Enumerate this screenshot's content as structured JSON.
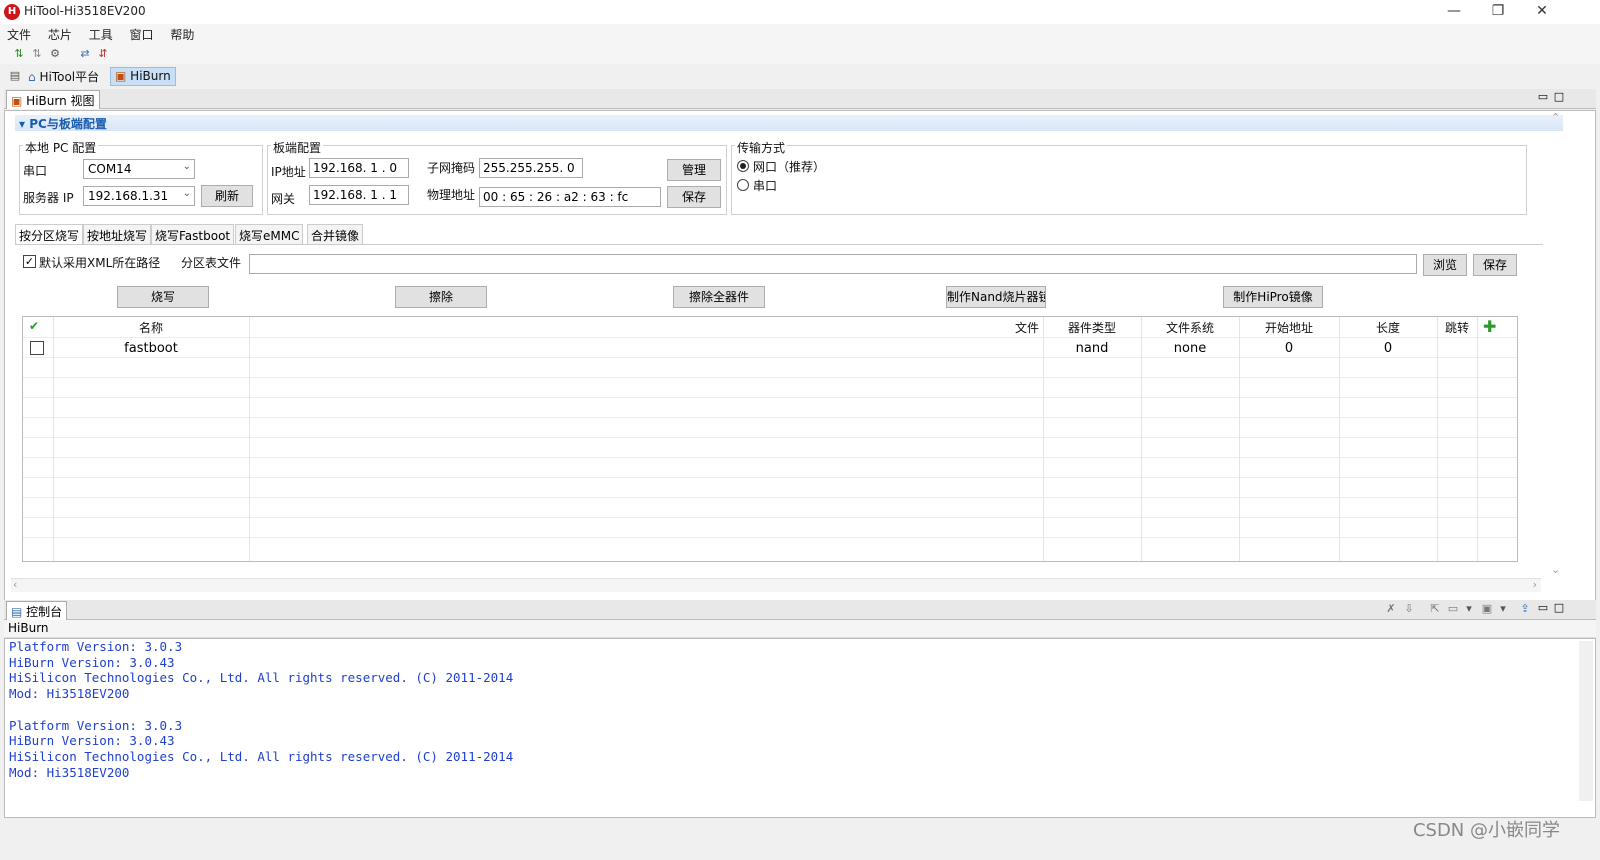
{
  "window": {
    "title": "HiTool-Hi3518EV200",
    "logo": "H",
    "minimize": "—",
    "restore": "❐",
    "close": "✕"
  },
  "menu": [
    "文件",
    "芯片",
    "工具",
    "窗口",
    "帮助"
  ],
  "perspectives": [
    {
      "label": "HiTool平台"
    },
    {
      "label": "HiBurn"
    }
  ],
  "view": {
    "title": "HiBurn 视图"
  },
  "section": {
    "title": "PC与板端配置"
  },
  "local_pc": {
    "legend": "本地 PC 配置",
    "serial_label": "串口",
    "serial_value": "COM14",
    "server_ip_label": "服务器 IP",
    "server_ip_value": "192.168.1.31",
    "refresh_button": "刷新"
  },
  "board": {
    "legend": "板端配置",
    "ip_label": "IP地址",
    "ip_value": "192.168. 1 . 0",
    "gateway_label": "网关",
    "gateway_value": "192.168. 1 . 1",
    "netmask_label": "子网掩码",
    "netmask_value": "255.255.255. 0",
    "mac_label": "物理地址",
    "mac_value": "00 : 65 : 26 : a2 : 63 : fc",
    "manage_button": "管理",
    "save_button": "保存"
  },
  "transfer": {
    "legend": "传输方式",
    "network_label": "网口（推荐）",
    "serial_label": "串口",
    "selected": "network"
  },
  "burn_tabs": [
    "按分区烧写",
    "按地址烧写",
    "烧写Fastboot",
    "烧写eMMC",
    "合并镜像"
  ],
  "partition": {
    "use_xml_path_label": "默认采用XML所在路径",
    "use_xml_path_checked": true,
    "table_file_label": "分区表文件",
    "table_file_value": "",
    "browse_button": "浏览",
    "save_button": "保存"
  },
  "actions": {
    "burn": "烧写",
    "erase": "擦除",
    "erase_all": "擦除全器件",
    "nand_image": "制作Nand烧片器镜像",
    "hipro_image": "制作HiPro镜像"
  },
  "table": {
    "headers": {
      "name": "名称",
      "file": "文件",
      "device_type": "器件类型",
      "filesystem": "文件系统",
      "start_address": "开始地址",
      "length": "长度",
      "jump": "跳转"
    },
    "rows": [
      {
        "checked": false,
        "name": "fastboot",
        "file": "",
        "device_type": "nand",
        "filesystem": "none",
        "start_address": "0",
        "length": "0"
      }
    ]
  },
  "console": {
    "title": "控制台",
    "subtitle": "HiBurn",
    "lines": [
      "Platform Version: 3.0.3",
      "HiBurn Version: 3.0.43",
      "HiSilicon Technologies Co., Ltd. All rights reserved. (C) 2011-2014",
      "Mod: Hi3518EV200",
      "",
      "Platform Version: 3.0.3",
      "HiBurn Version: 3.0.43",
      "HiSilicon Technologies Co., Ltd. All rights reserved. (C) 2011-2014",
      "Mod: Hi3518EV200"
    ],
    "text_color": "#1f3fd0"
  },
  "watermark": "CSDN @小嵌同学"
}
